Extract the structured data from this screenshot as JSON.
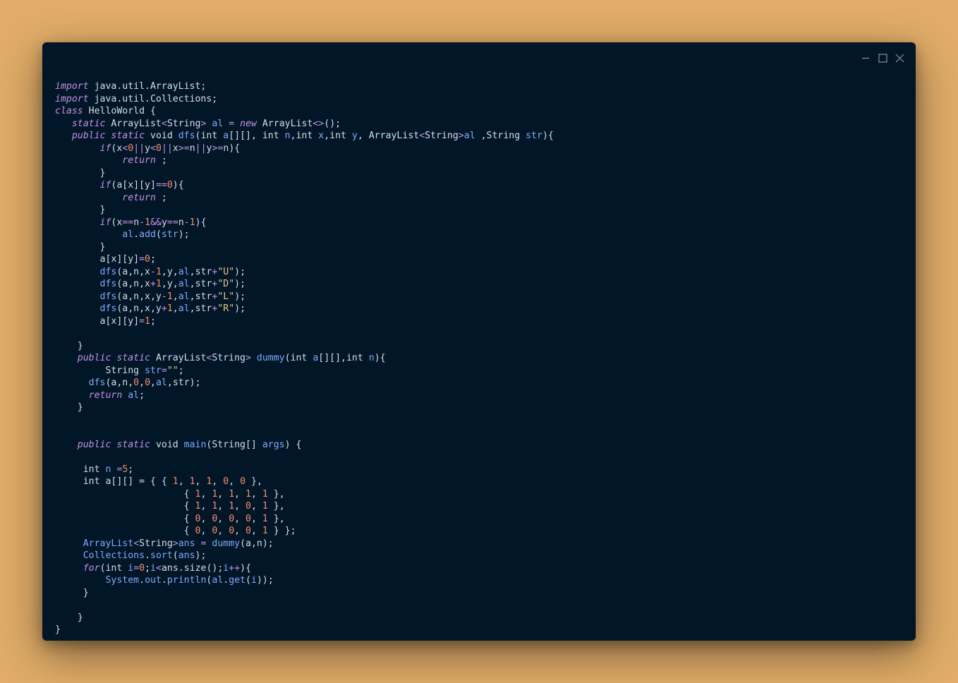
{
  "window": {
    "controls": [
      {
        "name": "minimize-icon"
      },
      {
        "name": "maximize-icon"
      },
      {
        "name": "close-icon"
      }
    ]
  },
  "colors": {
    "background": "#e0ac68",
    "editor": "#011627",
    "keyword": "#c792ea",
    "type": "#82aaff",
    "number": "#f78c6c",
    "string": "#ecc48d",
    "text": "#d6deeb"
  },
  "code": {
    "lines": [
      [
        [
          "kw",
          "import"
        ],
        [
          "p",
          " java.util.ArrayList;"
        ]
      ],
      [
        [
          "kw",
          "import"
        ],
        [
          "p",
          " java.util.Collections;"
        ]
      ],
      [
        [
          "kw",
          "class"
        ],
        [
          "p",
          " HelloWorld {"
        ]
      ],
      [
        [
          "p",
          "   "
        ],
        [
          "kw",
          "static"
        ],
        [
          "p",
          " ArrayList"
        ],
        [
          "op",
          "<"
        ],
        [
          "p",
          "String"
        ],
        [
          "op",
          ">"
        ],
        [
          "p",
          " "
        ],
        [
          "v",
          "al"
        ],
        [
          "p",
          " "
        ],
        [
          "op",
          "="
        ],
        [
          "p",
          " "
        ],
        [
          "kw",
          "new"
        ],
        [
          "p",
          " ArrayList"
        ],
        [
          "op",
          "<>"
        ],
        [
          "p",
          "();"
        ]
      ],
      [
        [
          "p",
          "   "
        ],
        [
          "kw",
          "public"
        ],
        [
          "p",
          " "
        ],
        [
          "kw",
          "static"
        ],
        [
          "p",
          " void "
        ],
        [
          "v",
          "dfs"
        ],
        [
          "p",
          "(int "
        ],
        [
          "v",
          "a"
        ],
        [
          "p",
          "[][], int "
        ],
        [
          "v",
          "n"
        ],
        [
          "p",
          ",int "
        ],
        [
          "v",
          "x"
        ],
        [
          "p",
          ",int "
        ],
        [
          "v",
          "y"
        ],
        [
          "p",
          ", ArrayList"
        ],
        [
          "op",
          "<"
        ],
        [
          "p",
          "String"
        ],
        [
          "op",
          ">"
        ],
        [
          "v",
          "al"
        ],
        [
          "p",
          " ,String "
        ],
        [
          "v",
          "str"
        ],
        [
          "p",
          "){"
        ]
      ],
      [
        [
          "p",
          "        "
        ],
        [
          "kw",
          "if"
        ],
        [
          "p",
          "(x"
        ],
        [
          "op",
          "<"
        ],
        [
          "n",
          "0"
        ],
        [
          "op",
          "||"
        ],
        [
          "p",
          "y"
        ],
        [
          "op",
          "<"
        ],
        [
          "n",
          "0"
        ],
        [
          "op",
          "||"
        ],
        [
          "p",
          "x"
        ],
        [
          "op",
          ">="
        ],
        [
          "p",
          "n"
        ],
        [
          "op",
          "||"
        ],
        [
          "p",
          "y"
        ],
        [
          "op",
          ">="
        ],
        [
          "p",
          "n){"
        ]
      ],
      [
        [
          "p",
          "            "
        ],
        [
          "kw",
          "return"
        ],
        [
          "p",
          " ;"
        ]
      ],
      [
        [
          "p",
          "        }"
        ]
      ],
      [
        [
          "p",
          "        "
        ],
        [
          "kw",
          "if"
        ],
        [
          "p",
          "(a[x][y]"
        ],
        [
          "op",
          "=="
        ],
        [
          "n",
          "0"
        ],
        [
          "p",
          "){"
        ]
      ],
      [
        [
          "p",
          "            "
        ],
        [
          "kw",
          "return"
        ],
        [
          "p",
          " ;"
        ]
      ],
      [
        [
          "p",
          "        }"
        ]
      ],
      [
        [
          "p",
          "        "
        ],
        [
          "kw",
          "if"
        ],
        [
          "p",
          "(x"
        ],
        [
          "op",
          "=="
        ],
        [
          "p",
          "n"
        ],
        [
          "op",
          "-"
        ],
        [
          "n",
          "1"
        ],
        [
          "op",
          "&&"
        ],
        [
          "p",
          "y"
        ],
        [
          "op",
          "=="
        ],
        [
          "p",
          "n"
        ],
        [
          "op",
          "-"
        ],
        [
          "n",
          "1"
        ],
        [
          "p",
          "){"
        ]
      ],
      [
        [
          "p",
          "            "
        ],
        [
          "v",
          "al"
        ],
        [
          "p",
          "."
        ],
        [
          "v",
          "add"
        ],
        [
          "p",
          "("
        ],
        [
          "v",
          "str"
        ],
        [
          "p",
          ");"
        ]
      ],
      [
        [
          "p",
          "        }"
        ]
      ],
      [
        [
          "p",
          "        a[x][y]"
        ],
        [
          "op",
          "="
        ],
        [
          "n",
          "0"
        ],
        [
          "p",
          ";"
        ]
      ],
      [
        [
          "p",
          "        "
        ],
        [
          "v",
          "dfs"
        ],
        [
          "p",
          "(a,n,x"
        ],
        [
          "op",
          "-"
        ],
        [
          "n",
          "1"
        ],
        [
          "p",
          ",y,"
        ],
        [
          "v",
          "al"
        ],
        [
          "p",
          ",str"
        ],
        [
          "op",
          "+"
        ],
        [
          "s",
          "\"U\""
        ],
        [
          "p",
          ");"
        ]
      ],
      [
        [
          "p",
          "        "
        ],
        [
          "v",
          "dfs"
        ],
        [
          "p",
          "(a,n,x"
        ],
        [
          "op",
          "+"
        ],
        [
          "n",
          "1"
        ],
        [
          "p",
          ",y,"
        ],
        [
          "v",
          "al"
        ],
        [
          "p",
          ",str"
        ],
        [
          "op",
          "+"
        ],
        [
          "s",
          "\"D\""
        ],
        [
          "p",
          ");"
        ]
      ],
      [
        [
          "p",
          "        "
        ],
        [
          "v",
          "dfs"
        ],
        [
          "p",
          "(a,n,x,y"
        ],
        [
          "op",
          "-"
        ],
        [
          "n",
          "1"
        ],
        [
          "p",
          ","
        ],
        [
          "v",
          "al"
        ],
        [
          "p",
          ",str"
        ],
        [
          "op",
          "+"
        ],
        [
          "s",
          "\"L\""
        ],
        [
          "p",
          ");"
        ]
      ],
      [
        [
          "p",
          "        "
        ],
        [
          "v",
          "dfs"
        ],
        [
          "p",
          "(a,n,x,y"
        ],
        [
          "op",
          "+"
        ],
        [
          "n",
          "1"
        ],
        [
          "p",
          ","
        ],
        [
          "v",
          "al"
        ],
        [
          "p",
          ",str"
        ],
        [
          "op",
          "+"
        ],
        [
          "s",
          "\"R\""
        ],
        [
          "p",
          ");"
        ]
      ],
      [
        [
          "p",
          "        a[x][y]"
        ],
        [
          "op",
          "="
        ],
        [
          "n",
          "1"
        ],
        [
          "p",
          ";"
        ]
      ],
      [
        [
          "p",
          ""
        ]
      ],
      [
        [
          "p",
          "    }"
        ]
      ],
      [
        [
          "p",
          "    "
        ],
        [
          "kw",
          "public"
        ],
        [
          "p",
          " "
        ],
        [
          "kw",
          "static"
        ],
        [
          "p",
          " ArrayList"
        ],
        [
          "op",
          "<"
        ],
        [
          "p",
          "String"
        ],
        [
          "op",
          ">"
        ],
        [
          "p",
          " "
        ],
        [
          "v",
          "dummy"
        ],
        [
          "p",
          "(int "
        ],
        [
          "v",
          "a"
        ],
        [
          "p",
          "[][],int "
        ],
        [
          "v",
          "n"
        ],
        [
          "p",
          "){"
        ]
      ],
      [
        [
          "p",
          "         String "
        ],
        [
          "v",
          "str"
        ],
        [
          "op",
          "="
        ],
        [
          "s",
          "\"\""
        ],
        [
          "p",
          ";"
        ]
      ],
      [
        [
          "p",
          "      "
        ],
        [
          "v",
          "dfs"
        ],
        [
          "p",
          "(a,n,"
        ],
        [
          "n",
          "0"
        ],
        [
          "p",
          ","
        ],
        [
          "n",
          "0"
        ],
        [
          "p",
          ","
        ],
        [
          "v",
          "al"
        ],
        [
          "p",
          ",str);"
        ]
      ],
      [
        [
          "p",
          "      "
        ],
        [
          "kw",
          "return"
        ],
        [
          "p",
          " "
        ],
        [
          "v",
          "al"
        ],
        [
          "p",
          ";"
        ]
      ],
      [
        [
          "p",
          "    }"
        ]
      ],
      [
        [
          "p",
          ""
        ]
      ],
      [
        [
          "p",
          ""
        ]
      ],
      [
        [
          "p",
          "    "
        ],
        [
          "kw",
          "public"
        ],
        [
          "p",
          " "
        ],
        [
          "kw",
          "static"
        ],
        [
          "p",
          " void "
        ],
        [
          "v",
          "main"
        ],
        [
          "p",
          "(String[] "
        ],
        [
          "v",
          "args"
        ],
        [
          "p",
          ") {"
        ]
      ],
      [
        [
          "p",
          ""
        ]
      ],
      [
        [
          "p",
          "     int "
        ],
        [
          "v",
          "n"
        ],
        [
          "p",
          " "
        ],
        [
          "op",
          "="
        ],
        [
          "n",
          "5"
        ],
        [
          "p",
          ";"
        ]
      ],
      [
        [
          "p",
          "     int a[][] = { { "
        ],
        [
          "n",
          "1"
        ],
        [
          "p",
          ", "
        ],
        [
          "n",
          "1"
        ],
        [
          "p",
          ", "
        ],
        [
          "n",
          "1"
        ],
        [
          "p",
          ", "
        ],
        [
          "n",
          "0"
        ],
        [
          "p",
          ", "
        ],
        [
          "n",
          "0"
        ],
        [
          "p",
          " },"
        ]
      ],
      [
        [
          "p",
          "                       { "
        ],
        [
          "n",
          "1"
        ],
        [
          "p",
          ", "
        ],
        [
          "n",
          "1"
        ],
        [
          "p",
          ", "
        ],
        [
          "n",
          "1"
        ],
        [
          "p",
          ", "
        ],
        [
          "n",
          "1"
        ],
        [
          "p",
          ", "
        ],
        [
          "n",
          "1"
        ],
        [
          "p",
          " },"
        ]
      ],
      [
        [
          "p",
          "                       { "
        ],
        [
          "n",
          "1"
        ],
        [
          "p",
          ", "
        ],
        [
          "n",
          "1"
        ],
        [
          "p",
          ", "
        ],
        [
          "n",
          "1"
        ],
        [
          "p",
          ", "
        ],
        [
          "n",
          "0"
        ],
        [
          "p",
          ", "
        ],
        [
          "n",
          "1"
        ],
        [
          "p",
          " },"
        ]
      ],
      [
        [
          "p",
          "                       { "
        ],
        [
          "n",
          "0"
        ],
        [
          "p",
          ", "
        ],
        [
          "n",
          "0"
        ],
        [
          "p",
          ", "
        ],
        [
          "n",
          "0"
        ],
        [
          "p",
          ", "
        ],
        [
          "n",
          "0"
        ],
        [
          "p",
          ", "
        ],
        [
          "n",
          "1"
        ],
        [
          "p",
          " },"
        ]
      ],
      [
        [
          "p",
          "                       { "
        ],
        [
          "n",
          "0"
        ],
        [
          "p",
          ", "
        ],
        [
          "n",
          "0"
        ],
        [
          "p",
          ", "
        ],
        [
          "n",
          "0"
        ],
        [
          "p",
          ", "
        ],
        [
          "n",
          "0"
        ],
        [
          "p",
          ", "
        ],
        [
          "n",
          "1"
        ],
        [
          "p",
          " } };"
        ]
      ],
      [
        [
          "p",
          "     "
        ],
        [
          "v",
          "ArrayList"
        ],
        [
          "op",
          "<"
        ],
        [
          "p",
          "String"
        ],
        [
          "op",
          ">"
        ],
        [
          "v",
          "ans"
        ],
        [
          "p",
          " "
        ],
        [
          "op",
          "="
        ],
        [
          "p",
          " "
        ],
        [
          "v",
          "dummy"
        ],
        [
          "p",
          "(a,n);"
        ]
      ],
      [
        [
          "p",
          "     "
        ],
        [
          "v",
          "Collections"
        ],
        [
          "p",
          "."
        ],
        [
          "v",
          "sort"
        ],
        [
          "p",
          "("
        ],
        [
          "v",
          "ans"
        ],
        [
          "p",
          ");"
        ]
      ],
      [
        [
          "p",
          "     "
        ],
        [
          "kw",
          "for"
        ],
        [
          "p",
          "(int "
        ],
        [
          "v",
          "i"
        ],
        [
          "op",
          "="
        ],
        [
          "n",
          "0"
        ],
        [
          "p",
          ";"
        ],
        [
          "v",
          "i"
        ],
        [
          "op",
          "<"
        ],
        [
          "p",
          "ans.size();"
        ],
        [
          "v",
          "i"
        ],
        [
          "op",
          "++"
        ],
        [
          "p",
          "){"
        ]
      ],
      [
        [
          "p",
          "         "
        ],
        [
          "v",
          "System"
        ],
        [
          "p",
          "."
        ],
        [
          "v",
          "out"
        ],
        [
          "p",
          "."
        ],
        [
          "v",
          "println"
        ],
        [
          "p",
          "("
        ],
        [
          "v",
          "al"
        ],
        [
          "p",
          "."
        ],
        [
          "v",
          "get"
        ],
        [
          "p",
          "("
        ],
        [
          "v",
          "i"
        ],
        [
          "p",
          "));"
        ]
      ],
      [
        [
          "p",
          "     }"
        ]
      ],
      [
        [
          "p",
          ""
        ]
      ],
      [
        [
          "p",
          "    }"
        ]
      ],
      [
        [
          "p",
          "}"
        ]
      ]
    ]
  }
}
